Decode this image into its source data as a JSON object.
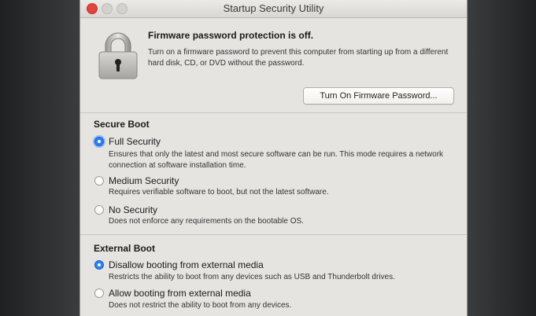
{
  "window": {
    "title": "Startup Security Utility"
  },
  "firmware": {
    "headline": "Firmware password protection is off.",
    "description": "Turn on a firmware password to prevent this computer from starting up from a different hard disk, CD, or DVD without the password.",
    "button_label": "Turn On Firmware Password..."
  },
  "secure_boot": {
    "title": "Secure Boot",
    "options": [
      {
        "label": "Full Security",
        "selected": true,
        "description": "Ensures that only the latest and most secure software can be run. This mode requires a network connection at software installation time."
      },
      {
        "label": "Medium Security",
        "selected": false,
        "description": "Requires verifiable software to boot, but not the latest software."
      },
      {
        "label": "No Security",
        "selected": false,
        "description": "Does not enforce any requirements on the bootable OS."
      }
    ]
  },
  "external_boot": {
    "title": "External Boot",
    "options": [
      {
        "label": "Disallow booting from external media",
        "selected": true,
        "description": "Restricts the ability to boot from any devices such as USB and Thunderbolt drives."
      },
      {
        "label": "Allow booting from external media",
        "selected": false,
        "description": "Does not restrict the ability to boot from any devices."
      }
    ]
  },
  "colors": {
    "accent": "#2d7ff0",
    "close": "#e0443e",
    "window_bg": "#e6e4e1"
  }
}
